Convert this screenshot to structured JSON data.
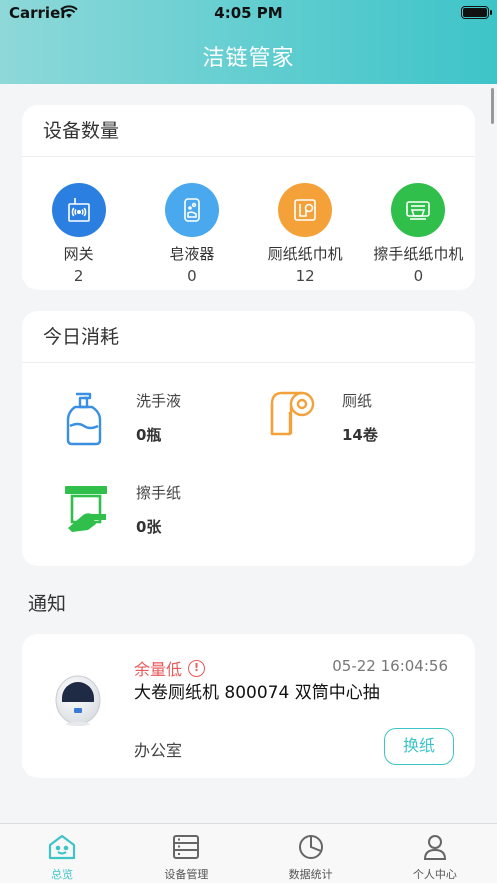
{
  "status_bar": {
    "carrier": "Carrier",
    "time": "4:05 PM"
  },
  "app": {
    "title": "洁链管家",
    "accent": "#3ec4c8"
  },
  "devices": {
    "title": "设备数量",
    "items": [
      {
        "label": "网关",
        "count": "2",
        "icon": "gateway-icon",
        "color": "#2b7fe0"
      },
      {
        "label": "皂液器",
        "count": "0",
        "icon": "soap-dispenser-icon",
        "color": "#4aa8ee"
      },
      {
        "label": "厕纸纸巾机",
        "count": "12",
        "icon": "toilet-paper-dispenser-icon",
        "color": "#f5a13a"
      },
      {
        "label": "擦手纸纸巾机",
        "count": "0",
        "icon": "hand-towel-dispenser-icon",
        "color": "#2fbf4a"
      }
    ]
  },
  "consumption": {
    "title": "今日消耗",
    "items": [
      {
        "name": "洗手液",
        "value": "0瓶",
        "icon": "hand-soap-icon",
        "color": "#3a8fe3"
      },
      {
        "name": "厕纸",
        "value": "14卷",
        "icon": "toilet-roll-icon",
        "color": "#f5a13a"
      },
      {
        "name": "擦手纸",
        "value": "0张",
        "icon": "hand-towel-icon",
        "color": "#2fbf4a"
      }
    ]
  },
  "notices": {
    "title": "通知",
    "items": [
      {
        "status": "余量低",
        "time": "05-22 16:04:56",
        "title": "大卷厕纸机 800074  双筒中心抽",
        "location": "办公室",
        "action": "换纸",
        "status_color": "#e85a5a"
      }
    ]
  },
  "tabs": [
    {
      "label": "总览",
      "icon": "home-icon",
      "active": true
    },
    {
      "label": "设备管理",
      "icon": "device-list-icon",
      "active": false
    },
    {
      "label": "数据统计",
      "icon": "pie-chart-icon",
      "active": false
    },
    {
      "label": "个人中心",
      "icon": "user-icon",
      "active": false
    }
  ]
}
